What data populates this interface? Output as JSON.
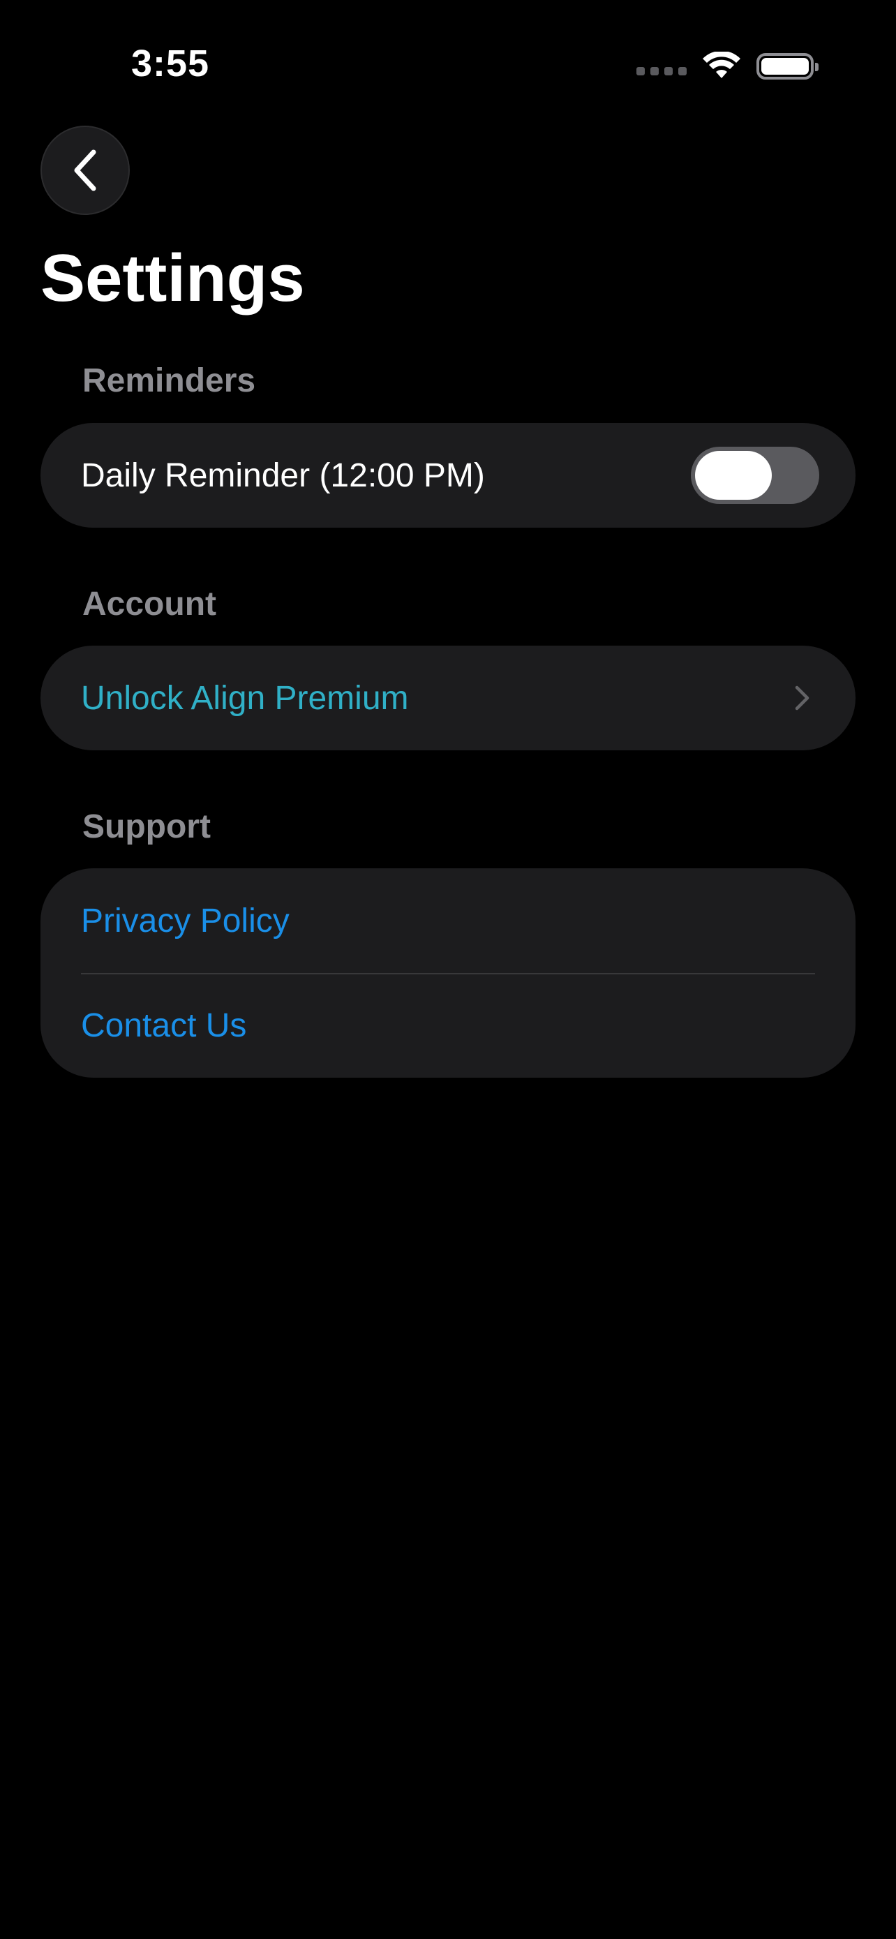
{
  "status_bar": {
    "time": "3:55",
    "icons": [
      "signal-dots-icon",
      "wifi-icon",
      "battery-icon"
    ]
  },
  "nav": {
    "back_icon": "chevron-left-icon",
    "title": "Settings"
  },
  "sections": {
    "reminders": {
      "header": "Reminders",
      "daily_reminder_label": "Daily Reminder (12:00 PM)",
      "daily_reminder_on": false
    },
    "account": {
      "header": "Account",
      "premium_label": "Unlock Align Premium",
      "premium_icon": "chevron-right-icon"
    },
    "support": {
      "header": "Support",
      "privacy_label": "Privacy Policy",
      "contact_label": "Contact Us"
    }
  },
  "colors": {
    "background": "#000000",
    "card": "#1c1c1e",
    "section_header": "#8e8e93",
    "premium_accent": "#30b0c7",
    "link_accent": "#1a8fe8",
    "toggle_off_track": "#5a5a5e"
  }
}
